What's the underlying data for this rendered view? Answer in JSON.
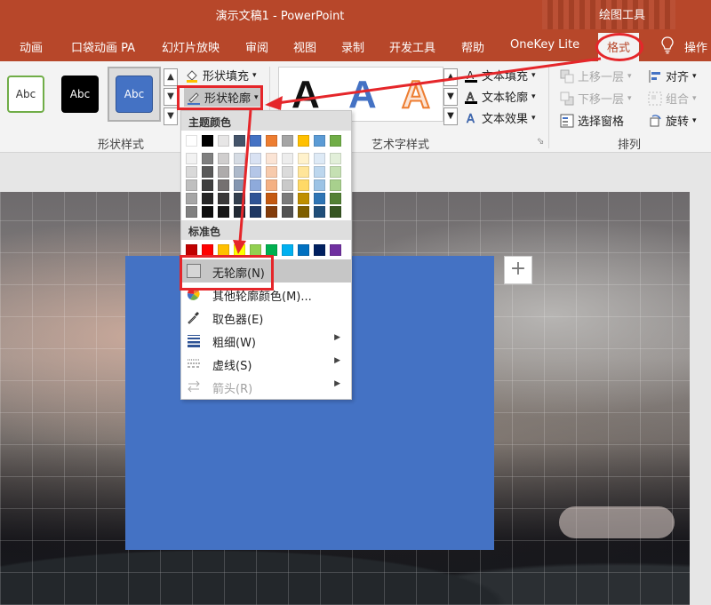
{
  "titlebar": {
    "title": "演示文稿1  -  PowerPoint",
    "context_label": "绘图工具",
    "bg_color": "#b7472a"
  },
  "tabs": [
    {
      "label": "动画"
    },
    {
      "label": "口袋动画 PA"
    },
    {
      "label": "幻灯片放映"
    },
    {
      "label": "审阅"
    },
    {
      "label": "视图"
    },
    {
      "label": "录制"
    },
    {
      "label": "开发工具"
    },
    {
      "label": "帮助"
    },
    {
      "label": "OneKey Lite"
    },
    {
      "label": "格式",
      "active": true
    },
    {
      "label": "操作"
    }
  ],
  "ribbon": {
    "shape_styles": {
      "group_label": "形状样式",
      "styles": [
        "Abc",
        "Abc",
        "Abc"
      ],
      "fill_label": "形状填充",
      "outline_label": "形状轮廓",
      "fill_dropdown": "▾",
      "outline_dropdown": "▾"
    },
    "art_text": {
      "group_label": "艺术字样式",
      "glyph": "A",
      "text_fill_label": "文本填充",
      "text_outline_label": "文本轮廓",
      "text_effect_label": "文本效果"
    },
    "arrange": {
      "group_label": "排列",
      "bring_forward": "上移一层",
      "send_backward": "下移一层",
      "selection_pane": "选择窗格",
      "align": "对齐",
      "group": "组合",
      "rotate": "旋转"
    }
  },
  "menu": {
    "theme_colors_label": "主题颜色",
    "theme_top_row": [
      "#ffffff",
      "#000000",
      "#e7e6e6",
      "#44546a",
      "#4472c4",
      "#ed7d31",
      "#a5a5a5",
      "#ffc000",
      "#5b9bd5",
      "#70ad47"
    ],
    "theme_shades": [
      [
        "#f2f2f2",
        "#7f7f7f",
        "#d0cece",
        "#d6dce4",
        "#d9e2f3",
        "#fbe4d5",
        "#ededed",
        "#fff2cc",
        "#deeaf6",
        "#e2efd9"
      ],
      [
        "#d9d9d9",
        "#595959",
        "#aeabab",
        "#adb9ca",
        "#b4c6e7",
        "#f7caac",
        "#dbdbdb",
        "#ffe599",
        "#bdd7ee",
        "#c5e0b3"
      ],
      [
        "#bfbfbf",
        "#404040",
        "#757171",
        "#8496b0",
        "#8eaadb",
        "#f4b083",
        "#c9c9c9",
        "#ffd966",
        "#9cc3e5",
        "#a8d08d"
      ],
      [
        "#a6a6a6",
        "#262626",
        "#3a3838",
        "#333f4f",
        "#2f5496",
        "#c45911",
        "#7b7b7b",
        "#bf8f00",
        "#2e75b5",
        "#538135"
      ],
      [
        "#808080",
        "#0d0d0d",
        "#171616",
        "#222a35",
        "#1f3864",
        "#833c0b",
        "#525252",
        "#7f5f00",
        "#1f4e79",
        "#375623"
      ]
    ],
    "standard_colors_label": "标准色",
    "standard_colors": [
      "#c00000",
      "#ff0000",
      "#ffc000",
      "#ffff00",
      "#92d050",
      "#00b050",
      "#00b0f0",
      "#0070c0",
      "#002060",
      "#7030a0"
    ],
    "items": {
      "no_outline": "无轮廓(N)",
      "more_colors": "其他轮廓颜色(M)...",
      "eyedropper": "取色器(E)",
      "weight": "粗细(W)",
      "dashes": "虚线(S)",
      "arrows": "箭头(R)"
    },
    "submenu_arrow": "▶"
  },
  "slide": {
    "rect_color": "#4472c4",
    "plus_glyph": "+"
  },
  "annotations": {
    "color": "#e5262a"
  }
}
